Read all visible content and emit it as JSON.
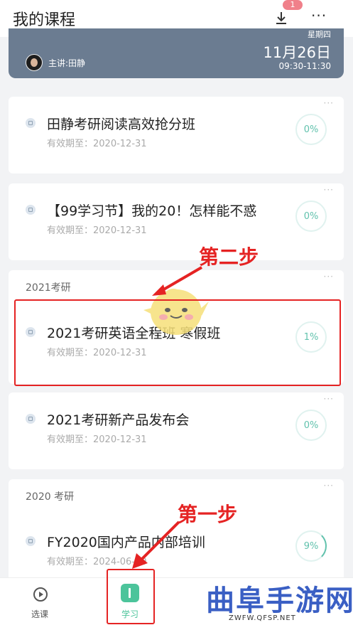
{
  "header": {
    "title": "我的课程",
    "download_badge": "1",
    "more_label": "···"
  },
  "live": {
    "weekday": "星期四",
    "date": "11月26日",
    "time": "09:30-11:30",
    "teacher": "主讲:田静"
  },
  "courses": [
    {
      "title": "田静考研阅读高效抢分班",
      "valid": "有效期至：2020-12-31",
      "progress": "0%"
    },
    {
      "title": "【99学习节】我的20！怎样能不惑",
      "valid": "有效期至：2020-12-31",
      "progress": "0%"
    },
    {
      "group": "2021考研",
      "title": "2021考研英语全程班 寒假班",
      "valid": "有效期至：2020-12-31",
      "progress": "1%"
    },
    {
      "title": "2021考研新产品发布会",
      "valid": "有效期至：2020-12-31",
      "progress": "0%"
    },
    {
      "group": "2020 考研",
      "title": "FY2020国内产品内部培训",
      "valid": "有效期至：2024-06-30",
      "progress": "9%"
    }
  ],
  "annotations": {
    "step2": "第二步",
    "step1": "第一步"
  },
  "tabbar": {
    "tab1": "选课",
    "tab2": "学习"
  },
  "watermark": {
    "text": "曲阜手游网",
    "url": "ZWFW.QFSP.NET"
  },
  "colors": {
    "accent": "#4cc49b",
    "annotation": "#e52323",
    "live_banner": "#6b7c91"
  }
}
